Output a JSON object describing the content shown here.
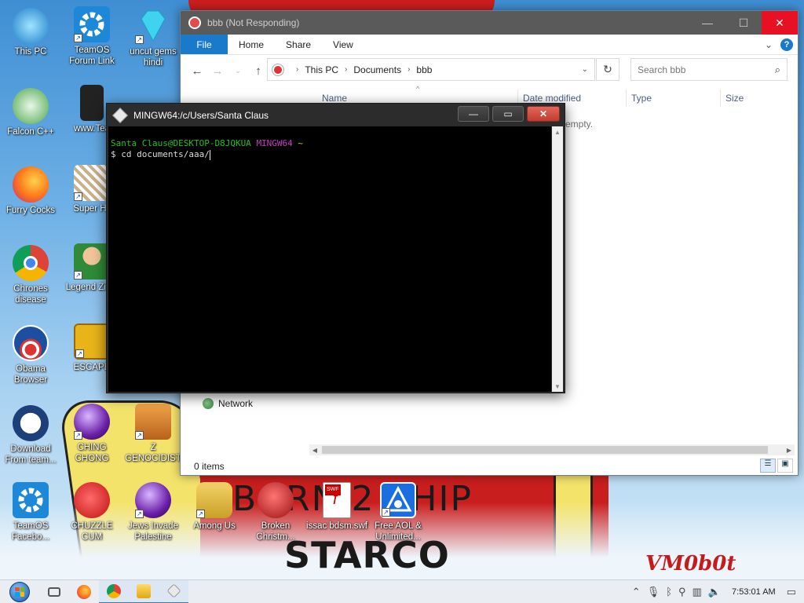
{
  "wallpaper": {
    "text_born": "BORN 2 SHIP",
    "text_starco": "STARCO",
    "signature": "VM0b0t"
  },
  "desktop_icons": [
    {
      "label": "This PC",
      "icon": "this-pc-icon"
    },
    {
      "label": "TeamOS Forum Link",
      "icon": "teamos-gear-icon"
    },
    {
      "label": "uncut gems hindi",
      "icon": "diamond-icon"
    },
    {
      "label": "Falcon C++",
      "icon": "falcon-icon"
    },
    {
      "label": "www.Tea",
      "icon": "book-icon"
    },
    {
      "label": "Furry Cocks",
      "icon": "firefox-icon"
    },
    {
      "label": "Super Hil",
      "icon": "game-sprite-icon"
    },
    {
      "label": "Chrones disease",
      "icon": "chrome-icon"
    },
    {
      "label": "Legend Zilda",
      "icon": "zelda-icon"
    },
    {
      "label": "Obama Browser",
      "icon": "obama-logo-icon"
    },
    {
      "label": "ESCAPE",
      "icon": "escape-box-icon"
    },
    {
      "label": "Download From team...",
      "icon": "download-icon"
    },
    {
      "label": "CHING CHONG",
      "icon": "orb-icon"
    },
    {
      "label": "Z GENOCIDIST",
      "icon": "z-game-icon"
    },
    {
      "label": "TeamOS Facebo...",
      "icon": "teamos-gear-icon"
    },
    {
      "label": "CHUZZLE CUM",
      "icon": "chuzzle-icon"
    },
    {
      "label": "Jews Invade Palestine",
      "icon": "orb-icon"
    },
    {
      "label": "Among Us",
      "icon": "among-us-icon"
    },
    {
      "label": "Broken Christm...",
      "icon": "ornament-icon"
    },
    {
      "label": "issac bdsm.swf",
      "icon": "swf-file-icon"
    },
    {
      "label": "Free AOL & Unlimited...",
      "icon": "aol-icon"
    }
  ],
  "explorer": {
    "title": "bbb (Not Responding)",
    "ribbon": {
      "file": "File",
      "tabs": [
        "Home",
        "Share",
        "View"
      ]
    },
    "breadcrumb": [
      "This PC",
      "Documents",
      "bbb"
    ],
    "search_placeholder": "Search bbb",
    "columns": [
      "Name",
      "Date modified",
      "Type",
      "Size"
    ],
    "empty_message": "empty.",
    "nav_network": "Network",
    "status": "0 items"
  },
  "terminal": {
    "title": "MINGW64:/c/Users/Santa Claus",
    "prompt_user": "Santa Claus@DESKTOP-D8JQKUA",
    "prompt_env": "MINGW64",
    "prompt_dir": "~",
    "command_line": "$ cd documents/aaa/"
  },
  "taskbar": {
    "clock": "7:53:01 AM",
    "apps": [
      "task-view-icon",
      "firefox-icon",
      "chrome-icon",
      "file-explorer-icon",
      "git-bash-icon"
    ]
  }
}
